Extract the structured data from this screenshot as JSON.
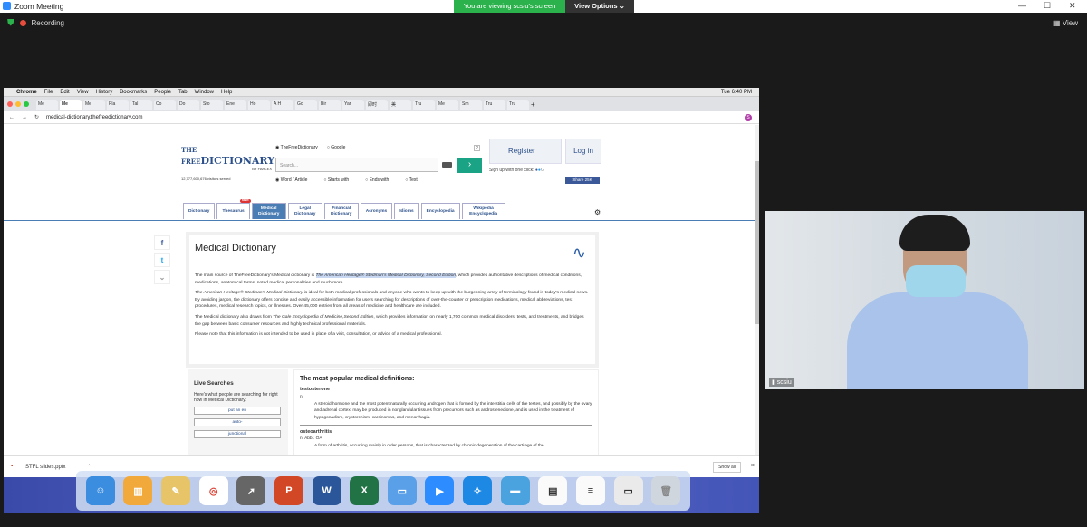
{
  "zoom": {
    "title": "Zoom Meeting",
    "viewing_text": "You are viewing scsiu's screen",
    "view_options": "View Options ⌄",
    "recording": "Recording",
    "view": "View"
  },
  "mac": {
    "apple": "",
    "app": "Chrome",
    "menu": [
      "File",
      "Edit",
      "View",
      "History",
      "Bookmarks",
      "People",
      "Tab",
      "Window",
      "Help"
    ],
    "time": "Tue 6:40 PM"
  },
  "browser": {
    "tabs": [
      "Me",
      "Me",
      "Me",
      "Pla",
      "Tal",
      "Co",
      "Do",
      "Sto",
      "Ene",
      "Ho",
      "A H",
      "Go",
      "Bir",
      "Yar",
      "即时",
      "美",
      "Tru",
      "Me",
      "Sm",
      "Tru",
      "Tru"
    ],
    "url": "medical-dictionary.thefreedictionary.com",
    "avatar": "S"
  },
  "site": {
    "logo_line1": "THE FREE",
    "logo_line2": "DICTIONARY",
    "logo_by": "BY FARLEX",
    "visitors": "12,777,600,676 visitors served",
    "radio_tfd": "TheFreeDictionary",
    "radio_google": "Google",
    "search_placeholder": "Search...",
    "qmark": "?",
    "search_go": "›",
    "modes": [
      "Word / Article",
      "Starts with",
      "Ends with",
      "Text"
    ],
    "register": "Register",
    "login": "Log in",
    "signup": "Sign up with one click:",
    "share": "Share 25K",
    "nav": [
      "Dictionary",
      "Thesaurus",
      "Medical Dictionary",
      "Legal Dictionary",
      "Financial Dictionary",
      "Acronyms",
      "Idioms",
      "Encyclopedia",
      "Wikipedia Encyclopedia"
    ],
    "new_badge": "new!"
  },
  "article": {
    "title": "Medical Dictionary",
    "p1_pre": "The main source of TheFreeDictionary's Medical dictionary is ",
    "p1_hl": "The American Heritage® Stedman's Medical Dictionary, Second Edition",
    "p1_post": ", which provides authoritative descriptions of medical conditions, medications, anatomical terms, noted medical personalities and much more.",
    "p2_em": "The American Heritage® Stedman's Medical Dictionary",
    "p2": " is ideal for both medical professionals and anyone who wants to keep up with the burgeoning array of terminology found in today's medical news. By avoiding jargon, the dictionary offers concise and easily accessible information for users searching for descriptions of over-the-counter or prescription medications, medical abbreviations, test procedures, medical research topics, or illnesses. Over 45,000 entries from all areas of medicine and healthcare are included.",
    "p3_pre": "The Medical dictionary also draws from ",
    "p3_em": "The Gale Encyclopedia of Medicine,Second Edition",
    "p3_post": ", which provides information on nearly 1,700 common medical disorders, tests, and treatments, and bridges the gap between basic consumer resources and highly technical professional materials.",
    "p4": "Please note that this information is not intended to be used in place of a visit, consultation, or advice of a medical professional."
  },
  "live": {
    "title": "Live Searches",
    "desc": "Here's what people are searching for right now in Medical Dictionary:",
    "items": [
      "put an en",
      "auto-",
      "junctional"
    ]
  },
  "popular": {
    "title": "The most popular medical definitions:",
    "t1": "testosterone",
    "n1": "n",
    "d1": "A steroid hormone and the most potent naturally occurring androgen that is formed by the interstitial cells of the testes, and possibly by the ovary and adrenal cortex, may be produced in nonglandular tissues from precursors such as androstenedione, and is used in the treatment of hypogonadism, cryptorchism, carcinomas, and menorrhagia.",
    "t2": "osteoarthritis",
    "n2": "n. Abbr. OA",
    "d2": "A form of arthritis, occurring mainly in older persons, that is characterized by chronic degeneration of the cartilage of the"
  },
  "download": {
    "file": "STFL slides.pptx",
    "show_all": "Show all",
    "close": "×"
  },
  "camera": {
    "name": "scsiu"
  }
}
